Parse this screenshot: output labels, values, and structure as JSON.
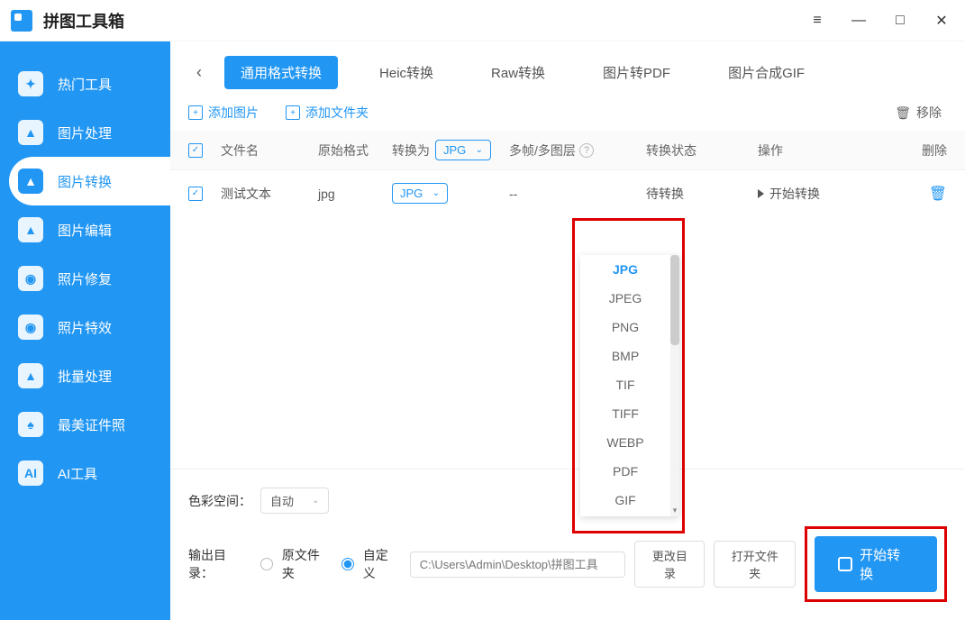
{
  "app_title": "拼图工具箱",
  "sidebar": {
    "items": [
      {
        "label": "热门工具",
        "icon": "✦"
      },
      {
        "label": "图片处理",
        "icon": "▲"
      },
      {
        "label": "图片转换",
        "icon": "▲"
      },
      {
        "label": "图片编辑",
        "icon": "▲"
      },
      {
        "label": "照片修复",
        "icon": "◉"
      },
      {
        "label": "照片特效",
        "icon": "◉"
      },
      {
        "label": "批量处理",
        "icon": "▲"
      },
      {
        "label": "最美证件照",
        "icon": "♠"
      },
      {
        "label": "AI工具",
        "icon": "AI"
      }
    ],
    "active_index": 2
  },
  "tabs": [
    {
      "label": "通用格式转换",
      "active": true
    },
    {
      "label": "Heic转换"
    },
    {
      "label": "Raw转换"
    },
    {
      "label": "图片转PDF"
    },
    {
      "label": "图片合成GIF"
    }
  ],
  "toolbar": {
    "add_image": "添加图片",
    "add_folder": "添加文件夹",
    "remove": "移除"
  },
  "columns": {
    "name": "文件名",
    "orig": "原始格式",
    "conv": "转换为",
    "conv_value": "JPG",
    "frame": "多帧/多图层",
    "status": "转换状态",
    "action": "操作",
    "delete": "删除"
  },
  "rows": [
    {
      "name": "测试文本",
      "orig": "jpg",
      "conv": "JPG",
      "frame": "--",
      "status": "待转换",
      "action": "开始转换"
    }
  ],
  "dropdown_options": [
    "JPG",
    "JPEG",
    "PNG",
    "BMP",
    "TIF",
    "TIFF",
    "WEBP",
    "PDF",
    "GIF"
  ],
  "footer": {
    "color_space_label": "色彩空间：",
    "color_space_value": "自动",
    "output_label": "输出目录：",
    "radio_orig": "原文件夹",
    "radio_custom": "自定义",
    "path_placeholder": "C:\\Users\\Admin\\Desktop\\拼图工具",
    "change_dir": "更改目录",
    "open_folder": "打开文件夹",
    "start": "开始转换"
  }
}
